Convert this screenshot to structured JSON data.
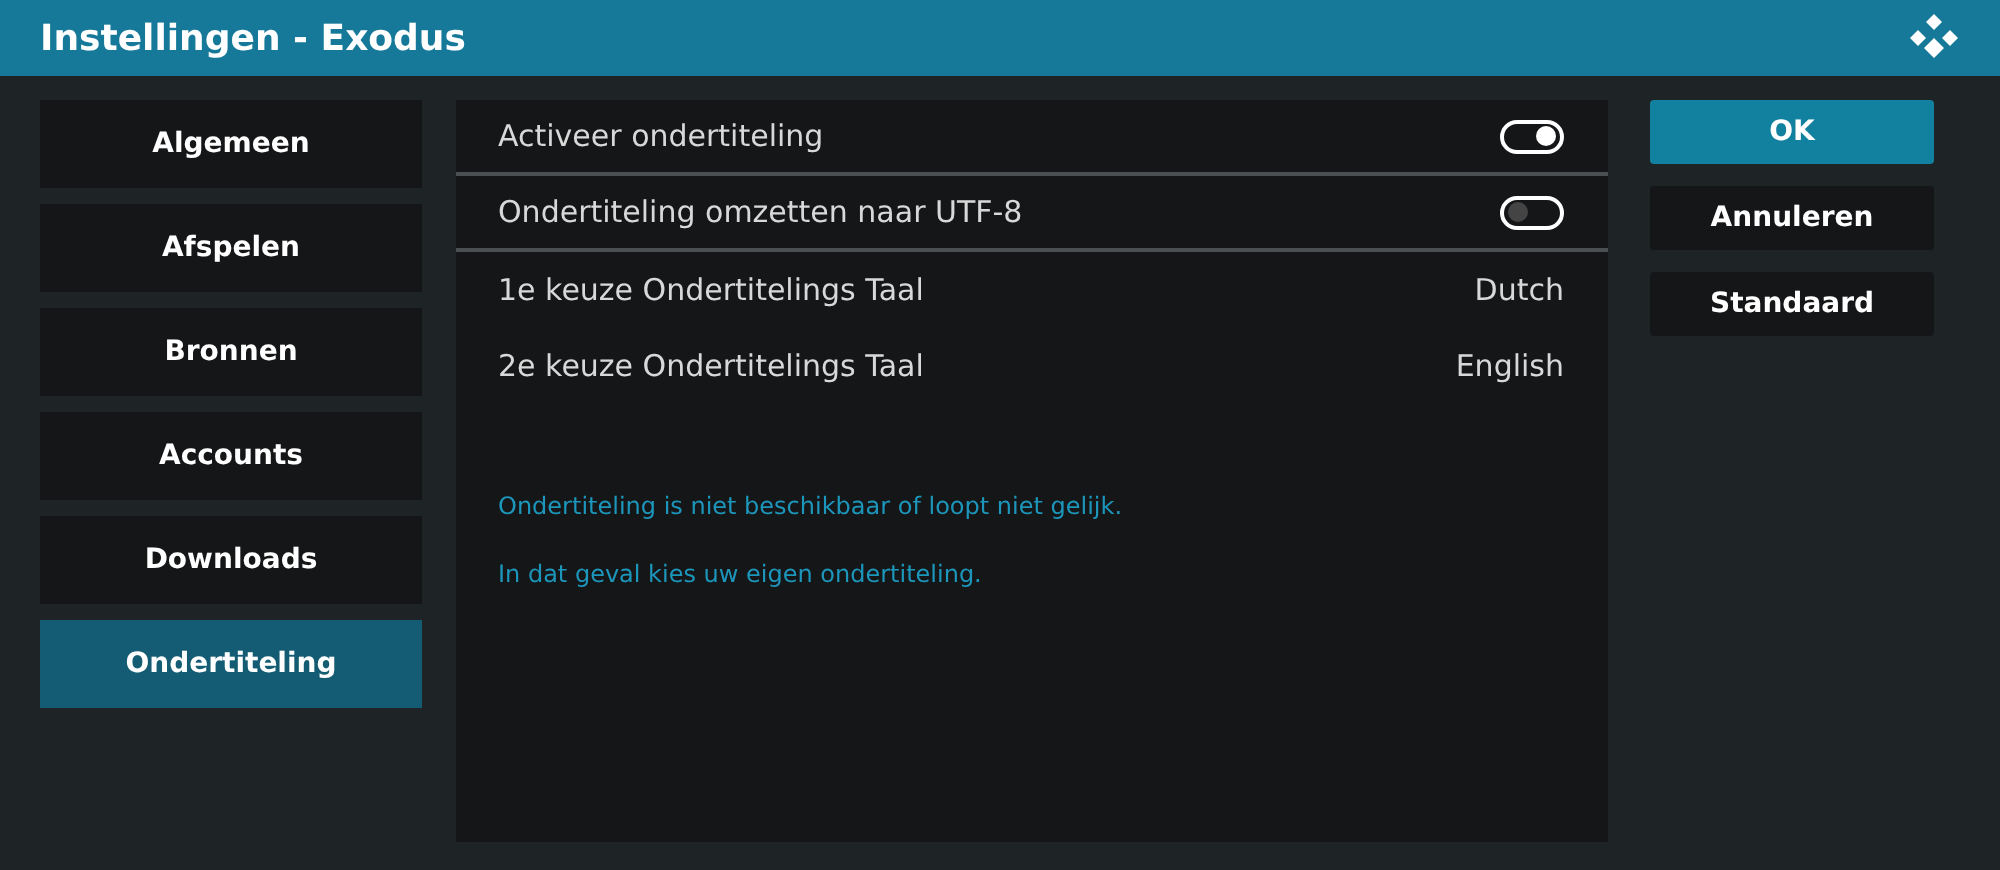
{
  "window": {
    "title": "Instellingen - Exodus"
  },
  "categories": [
    {
      "label": "Algemeen",
      "selected": false
    },
    {
      "label": "Afspelen",
      "selected": false
    },
    {
      "label": "Bronnen",
      "selected": false
    },
    {
      "label": "Accounts",
      "selected": false
    },
    {
      "label": "Downloads",
      "selected": false
    },
    {
      "label": "Ondertiteling",
      "selected": true
    }
  ],
  "settings": [
    {
      "kind": "toggle",
      "label": "Activeer ondertiteling",
      "on": true
    },
    {
      "kind": "toggle",
      "label": "Ondertiteling omzetten naar UTF-8",
      "on": false
    },
    {
      "kind": "value",
      "label": "1e keuze Ondertitelings Taal",
      "value": "Dutch"
    },
    {
      "kind": "value",
      "label": "2e keuze Ondertitelings Taal",
      "value": "English"
    }
  ],
  "notes": [
    "Ondertiteling is niet beschikbaar of loopt niet gelijk.",
    "In dat geval kies uw eigen ondertiteling."
  ],
  "buttons": [
    {
      "label": "OK",
      "selected": true
    },
    {
      "label": "Annuleren",
      "selected": false
    },
    {
      "label": "Standaard",
      "selected": false
    }
  ]
}
